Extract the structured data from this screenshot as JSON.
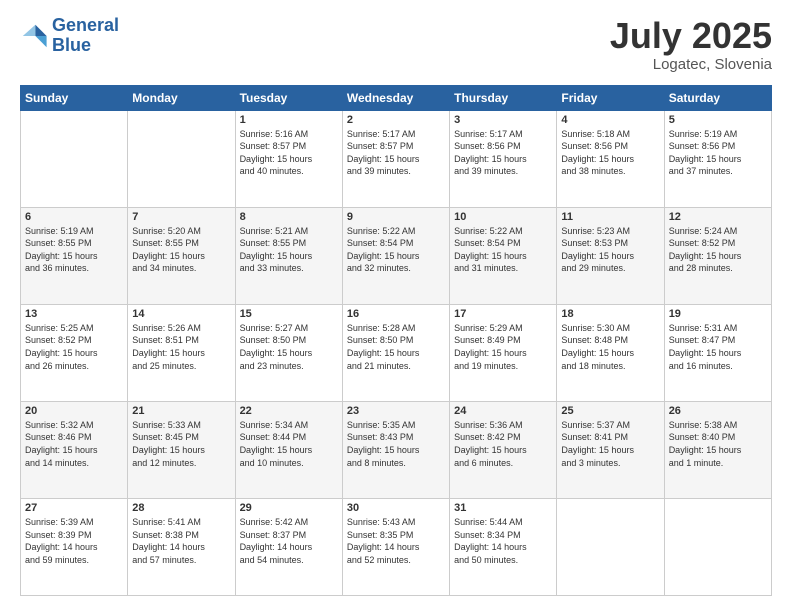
{
  "header": {
    "logo_line1": "General",
    "logo_line2": "Blue",
    "month": "July 2025",
    "location": "Logatec, Slovenia"
  },
  "weekdays": [
    "Sunday",
    "Monday",
    "Tuesday",
    "Wednesday",
    "Thursday",
    "Friday",
    "Saturday"
  ],
  "weeks": [
    [
      {
        "day": "",
        "info": ""
      },
      {
        "day": "",
        "info": ""
      },
      {
        "day": "1",
        "info": "Sunrise: 5:16 AM\nSunset: 8:57 PM\nDaylight: 15 hours\nand 40 minutes."
      },
      {
        "day": "2",
        "info": "Sunrise: 5:17 AM\nSunset: 8:57 PM\nDaylight: 15 hours\nand 39 minutes."
      },
      {
        "day": "3",
        "info": "Sunrise: 5:17 AM\nSunset: 8:56 PM\nDaylight: 15 hours\nand 39 minutes."
      },
      {
        "day": "4",
        "info": "Sunrise: 5:18 AM\nSunset: 8:56 PM\nDaylight: 15 hours\nand 38 minutes."
      },
      {
        "day": "5",
        "info": "Sunrise: 5:19 AM\nSunset: 8:56 PM\nDaylight: 15 hours\nand 37 minutes."
      }
    ],
    [
      {
        "day": "6",
        "info": "Sunrise: 5:19 AM\nSunset: 8:55 PM\nDaylight: 15 hours\nand 36 minutes."
      },
      {
        "day": "7",
        "info": "Sunrise: 5:20 AM\nSunset: 8:55 PM\nDaylight: 15 hours\nand 34 minutes."
      },
      {
        "day": "8",
        "info": "Sunrise: 5:21 AM\nSunset: 8:55 PM\nDaylight: 15 hours\nand 33 minutes."
      },
      {
        "day": "9",
        "info": "Sunrise: 5:22 AM\nSunset: 8:54 PM\nDaylight: 15 hours\nand 32 minutes."
      },
      {
        "day": "10",
        "info": "Sunrise: 5:22 AM\nSunset: 8:54 PM\nDaylight: 15 hours\nand 31 minutes."
      },
      {
        "day": "11",
        "info": "Sunrise: 5:23 AM\nSunset: 8:53 PM\nDaylight: 15 hours\nand 29 minutes."
      },
      {
        "day": "12",
        "info": "Sunrise: 5:24 AM\nSunset: 8:52 PM\nDaylight: 15 hours\nand 28 minutes."
      }
    ],
    [
      {
        "day": "13",
        "info": "Sunrise: 5:25 AM\nSunset: 8:52 PM\nDaylight: 15 hours\nand 26 minutes."
      },
      {
        "day": "14",
        "info": "Sunrise: 5:26 AM\nSunset: 8:51 PM\nDaylight: 15 hours\nand 25 minutes."
      },
      {
        "day": "15",
        "info": "Sunrise: 5:27 AM\nSunset: 8:50 PM\nDaylight: 15 hours\nand 23 minutes."
      },
      {
        "day": "16",
        "info": "Sunrise: 5:28 AM\nSunset: 8:50 PM\nDaylight: 15 hours\nand 21 minutes."
      },
      {
        "day": "17",
        "info": "Sunrise: 5:29 AM\nSunset: 8:49 PM\nDaylight: 15 hours\nand 19 minutes."
      },
      {
        "day": "18",
        "info": "Sunrise: 5:30 AM\nSunset: 8:48 PM\nDaylight: 15 hours\nand 18 minutes."
      },
      {
        "day": "19",
        "info": "Sunrise: 5:31 AM\nSunset: 8:47 PM\nDaylight: 15 hours\nand 16 minutes."
      }
    ],
    [
      {
        "day": "20",
        "info": "Sunrise: 5:32 AM\nSunset: 8:46 PM\nDaylight: 15 hours\nand 14 minutes."
      },
      {
        "day": "21",
        "info": "Sunrise: 5:33 AM\nSunset: 8:45 PM\nDaylight: 15 hours\nand 12 minutes."
      },
      {
        "day": "22",
        "info": "Sunrise: 5:34 AM\nSunset: 8:44 PM\nDaylight: 15 hours\nand 10 minutes."
      },
      {
        "day": "23",
        "info": "Sunrise: 5:35 AM\nSunset: 8:43 PM\nDaylight: 15 hours\nand 8 minutes."
      },
      {
        "day": "24",
        "info": "Sunrise: 5:36 AM\nSunset: 8:42 PM\nDaylight: 15 hours\nand 6 minutes."
      },
      {
        "day": "25",
        "info": "Sunrise: 5:37 AM\nSunset: 8:41 PM\nDaylight: 15 hours\nand 3 minutes."
      },
      {
        "day": "26",
        "info": "Sunrise: 5:38 AM\nSunset: 8:40 PM\nDaylight: 15 hours\nand 1 minute."
      }
    ],
    [
      {
        "day": "27",
        "info": "Sunrise: 5:39 AM\nSunset: 8:39 PM\nDaylight: 14 hours\nand 59 minutes."
      },
      {
        "day": "28",
        "info": "Sunrise: 5:41 AM\nSunset: 8:38 PM\nDaylight: 14 hours\nand 57 minutes."
      },
      {
        "day": "29",
        "info": "Sunrise: 5:42 AM\nSunset: 8:37 PM\nDaylight: 14 hours\nand 54 minutes."
      },
      {
        "day": "30",
        "info": "Sunrise: 5:43 AM\nSunset: 8:35 PM\nDaylight: 14 hours\nand 52 minutes."
      },
      {
        "day": "31",
        "info": "Sunrise: 5:44 AM\nSunset: 8:34 PM\nDaylight: 14 hours\nand 50 minutes."
      },
      {
        "day": "",
        "info": ""
      },
      {
        "day": "",
        "info": ""
      }
    ]
  ]
}
